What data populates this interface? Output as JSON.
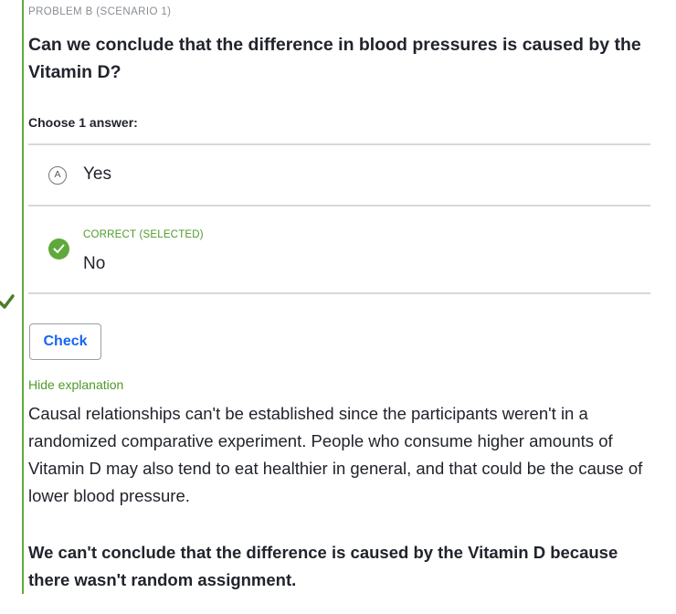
{
  "problem": {
    "label": "PROBLEM B (SCENARIO 1)",
    "question": "Can we conclude that the difference in blood pressures is caused by the Vitamin D?",
    "instruction": "Choose 1 answer:"
  },
  "choices": [
    {
      "letter": "A",
      "text": "Yes",
      "status": ""
    },
    {
      "letter": "B",
      "text": "No",
      "status": "CORRECT (SELECTED)"
    }
  ],
  "check_button": {
    "label": "Check"
  },
  "explanation": {
    "toggle_label": "Hide explanation",
    "body": "Causal relationships can't be established since the participants weren't in a randomized comparative experiment. People who consume higher amounts of Vitamin D may also tend to eat healthier in general, and that could be the cause of lower blood pressure.",
    "conclusion": "We can't conclude that the difference is caused by the Vitamin D because there wasn't random assignment."
  },
  "colors": {
    "accent_green": "#5fa93a",
    "link_blue": "#1865f2",
    "text": "#21242c"
  }
}
